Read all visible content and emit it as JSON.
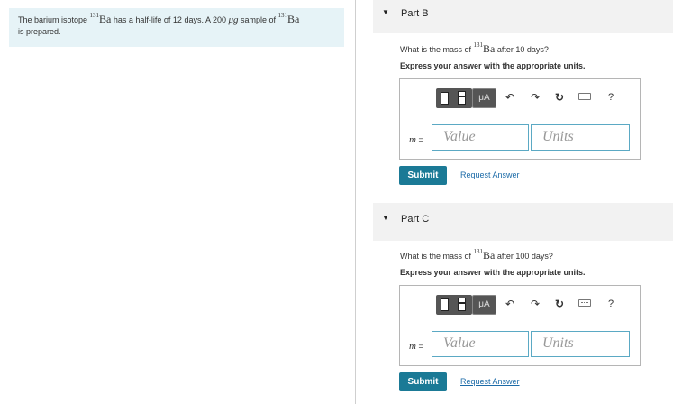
{
  "problem": {
    "text_prefix": "The barium isotope ",
    "isotope_mass_number": "131",
    "isotope_symbol": "Ba",
    "text_middle_1": " has a half-life of 12 days. A 200 ",
    "unit": "μg",
    "text_middle_2": " sample of ",
    "text_suffix": "is prepared."
  },
  "parts": [
    {
      "title": "Part B",
      "question_prefix": "What is the mass of ",
      "isotope_mass_number": "131",
      "isotope_symbol": "Ba",
      "question_suffix": " after 10 days?",
      "instruction": "Express your answer with the appropriate units.",
      "variable": "m",
      "equals": " =",
      "value_placeholder": "Value",
      "units_placeholder": "Units",
      "submit_label": "Submit",
      "request_label": "Request Answer"
    },
    {
      "title": "Part C",
      "question_prefix": "What is the mass of ",
      "isotope_mass_number": "131",
      "isotope_symbol": "Ba",
      "question_suffix": " after 100 days?",
      "instruction": "Express your answer with the appropriate units.",
      "variable": "m",
      "equals": " =",
      "value_placeholder": "Value",
      "units_placeholder": "Units",
      "submit_label": "Submit",
      "request_label": "Request Answer"
    }
  ],
  "toolbar": {
    "units_button_label": "μA",
    "undo_icon": "↶",
    "redo_icon": "↷",
    "reset_icon": "↻",
    "help_icon": "?"
  },
  "icons": {
    "caret": "▼"
  }
}
